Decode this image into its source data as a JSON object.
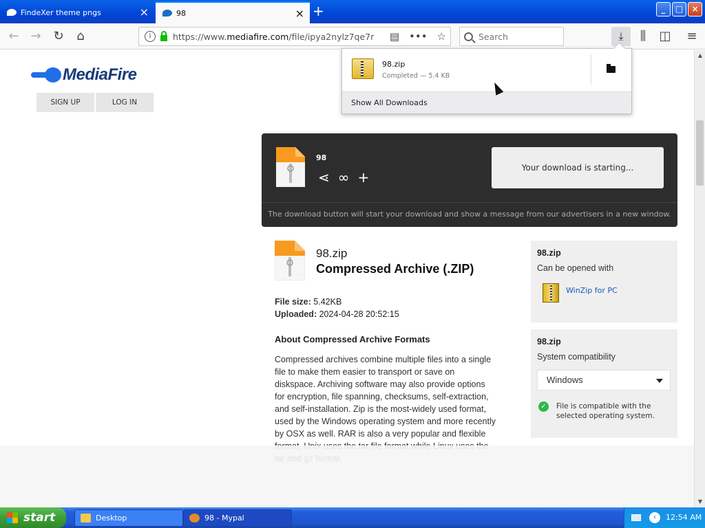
{
  "browser": {
    "tabs": [
      {
        "title": "FindeXer theme pngs",
        "active": false
      },
      {
        "title": "98",
        "active": true
      }
    ],
    "url_prefix": "https://www.",
    "url_domain": "mediafire.com",
    "url_path": "/file/ipya2nylz7qe7r",
    "search_placeholder": "Search"
  },
  "downloads_panel": {
    "file_name": "98.zip",
    "status": "Completed — 5.4 KB",
    "show_all": "Show All Downloads"
  },
  "site": {
    "logo_text": "MediaFire",
    "sign_up": "SIGN UP",
    "log_in": "LOG IN"
  },
  "download_box": {
    "file_name": "98",
    "starting": "Your download is starting...",
    "note": "The download button will start your download and show a message from our advertisers in a new window."
  },
  "file_info": {
    "name": "98.zip",
    "type": "Compressed Archive (.ZIP)",
    "size_label": "File size:",
    "size_value": "5.42KB",
    "uploaded_label": "Uploaded:",
    "uploaded_value": "2024-04-28 20:52:15",
    "about_heading": "About Compressed Archive Formats",
    "about_text": "Compressed archives combine multiple files into a single file to make them easier to transport or save on diskspace. Archiving software may also provide options for encryption, file spanning, checksums, self-extraction, and self-installation. Zip is the most-widely used format, used by the Windows operating system and more recently by OSX as well. RAR is also a very popular and flexible format. Unix uses the tar file format while Linux uses the tar and gz format."
  },
  "side_open": {
    "title": "98.zip",
    "subtitle": "Can be opened with",
    "app": "WinZip for PC"
  },
  "side_compat": {
    "title": "98.zip",
    "subtitle": "System compatibility",
    "os_selected": "Windows",
    "compat_text": "File is compatible with the selected operating system."
  },
  "taskbar": {
    "start": "start",
    "tasks": [
      "Desktop",
      "98 - Mypal"
    ],
    "clock": "12:54 AM"
  }
}
